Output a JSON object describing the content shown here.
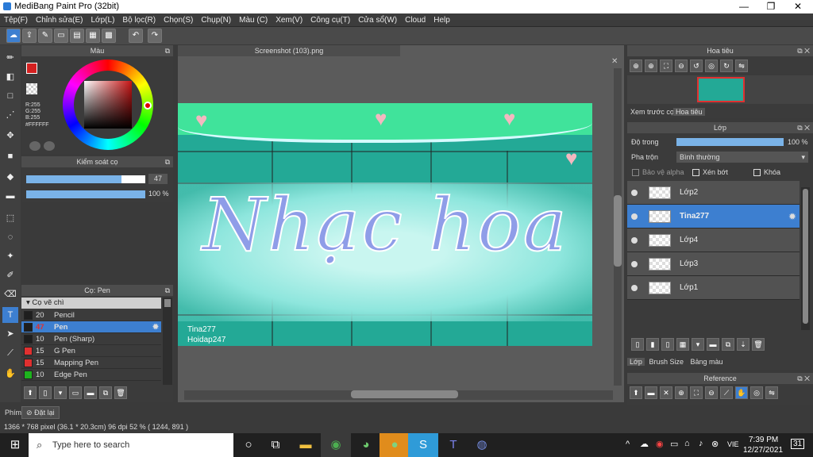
{
  "window": {
    "title": "MediBang Paint Pro (32bit)",
    "minimize": "—",
    "restore": "❐",
    "close": "✕"
  },
  "menu": [
    "Tệp(F)",
    "Chỉnh sửa(E)",
    "Lớp(L)",
    "Bộ lọc(R)",
    "Chọn(S)",
    "Chụp(N)",
    "Màu (C)",
    "Xem(V)",
    "Công cụ(T)",
    "Cửa sổ(W)",
    "Cloud",
    "Help"
  ],
  "color_panel": {
    "title": "Màu",
    "r": "R:255",
    "g": "G:255",
    "b": "B:255",
    "hex": "#FFFFFF",
    "primary": "#d42020",
    "wheel_color": "#c71414"
  },
  "brush_control": {
    "title": "Kiểm soát cọ",
    "size_value": "47",
    "size_fraction": 0.8,
    "opacity_value": "100 %",
    "opacity_fraction": 1.0
  },
  "brush_panel": {
    "title": "Cọ: Pen",
    "group": "Cọ vẽ chì",
    "items": [
      {
        "size": "20",
        "name": "Pencil",
        "swatch": "#1e1e1e",
        "selected": false
      },
      {
        "size": "47",
        "name": "Pen",
        "swatch": "#1e1e1e",
        "selected": true
      },
      {
        "size": "10",
        "name": "Pen (Sharp)",
        "swatch": "#1e1e1e",
        "selected": false
      },
      {
        "size": "15",
        "name": "G Pen",
        "swatch": "#e03030",
        "selected": false
      },
      {
        "size": "15",
        "name": "Mapping Pen",
        "swatch": "#e03030",
        "selected": false
      },
      {
        "size": "10",
        "name": "Edge Pen",
        "swatch": "#1db31d",
        "selected": false
      }
    ]
  },
  "document": {
    "tab": "Screenshot (103).png",
    "art_text": "Nhạc hoa",
    "credit1": "Tina277",
    "credit2": "Hoidap247"
  },
  "navigator": {
    "title": "Hoa tiêu",
    "tab_preview": "Xem trước cọ",
    "tab_nav": "Hoa tiêu"
  },
  "layer_panel": {
    "title": "Lớp",
    "opacity_label": "Độ trong",
    "opacity_value": "100 %",
    "blend_label": "Pha trộn",
    "blend_value": "Bình thường",
    "protect_alpha": "Bảo vệ alpha",
    "clip": "Xén bớt",
    "lock": "Khóa",
    "layers": [
      {
        "name": "Lớp2",
        "selected": false
      },
      {
        "name": "Tina277",
        "selected": true
      },
      {
        "name": "Lớp4",
        "selected": false
      },
      {
        "name": "Lớp3",
        "selected": false
      },
      {
        "name": "Lớp1",
        "selected": false
      }
    ],
    "bottom_tabs": [
      "Lớp",
      "Brush Size",
      "Bảng màu"
    ]
  },
  "reference": {
    "title": "Reference"
  },
  "bottom": {
    "shortcut_tab": "Phím",
    "undo_label": "Đặt lại",
    "status": "1366 * 768 pixel   (36.1 * 20.3cm)   96 dpi   52 %   ( 1244, 891 )"
  },
  "taskbar": {
    "search_placeholder": "Type here to search",
    "lang": "VIE",
    "time": "7:39 PM",
    "date": "12/27/2021",
    "notif": "31"
  }
}
